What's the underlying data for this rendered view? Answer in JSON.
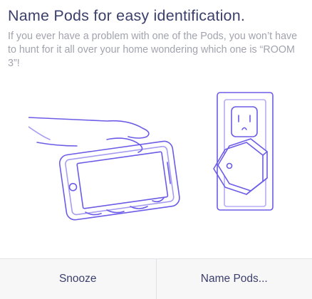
{
  "dialog": {
    "title": "Name Pods for easy identification.",
    "description": "If you ever have a problem with one of the Pods, you won’t have to hunt for it all over your home wondering which one is “ROOM 3”!",
    "illustration_icons": [
      "hand-holding-phone-icon",
      "wall-outlet-icon",
      "pod-device-icon"
    ],
    "accent_color": "#6b5ce7",
    "title_color": "#3b3f6c"
  },
  "footer": {
    "snooze_label": "Snooze",
    "name_pods_label": "Name Pods..."
  }
}
